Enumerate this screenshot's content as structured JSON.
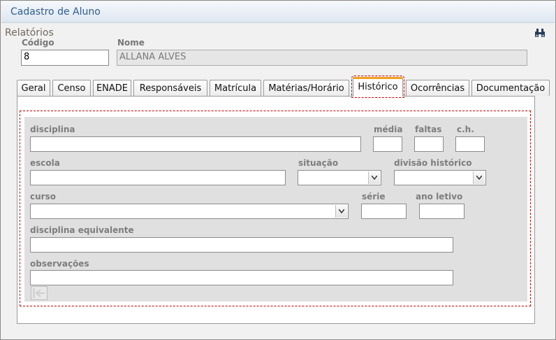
{
  "window": {
    "title": "Cadastro de Aluno"
  },
  "toolbar": {
    "relatorios": "Relatórios",
    "search_icon": "binoculars-icon"
  },
  "header": {
    "codigo_label": "Código",
    "codigo_value": "8",
    "nome_label": "Nome",
    "nome_value": "ALLANA ALVES"
  },
  "tabs": [
    {
      "label": "Geral"
    },
    {
      "label": "Censo"
    },
    {
      "label": "ENADE"
    },
    {
      "label": "Responsáveis"
    },
    {
      "label": "Matrícula"
    },
    {
      "label": "Matérias/Horário"
    },
    {
      "label": "Histórico",
      "active": true
    },
    {
      "label": "Ocorrências"
    },
    {
      "label": "Documentação"
    }
  ],
  "form": {
    "disciplina": "disciplina",
    "media": "média",
    "faltas": "faltas",
    "ch": "c.h.",
    "escola": "escola",
    "situacao": "situação",
    "divisao": "divisão histórico",
    "curso": "curso",
    "serie": "série",
    "ano_letivo": "ano letivo",
    "disciplina_equivalente": "disciplina equivalente",
    "observacoes": "observações"
  },
  "colors": {
    "accent_tab": "#f0a020",
    "selection_outline": "#cc0000",
    "title": "#2f5d8f"
  }
}
